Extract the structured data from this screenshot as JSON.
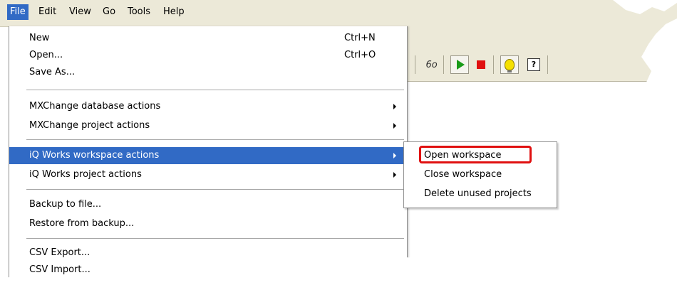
{
  "menubar": {
    "items": [
      {
        "label": "File"
      },
      {
        "label": "Edit"
      },
      {
        "label": "View"
      },
      {
        "label": "Go"
      },
      {
        "label": "Tools"
      },
      {
        "label": "Help"
      }
    ]
  },
  "file_menu": {
    "items": [
      {
        "label": "New",
        "shortcut": "Ctrl+N"
      },
      {
        "label": "Open...",
        "shortcut": "Ctrl+O"
      },
      {
        "label": "Save As..."
      },
      {
        "label": "MXChange database actions"
      },
      {
        "label": "MXChange project actions"
      },
      {
        "label": "iQ Works workspace actions"
      },
      {
        "label": "iQ Works project actions"
      },
      {
        "label": "Backup to file..."
      },
      {
        "label": "Restore from backup..."
      },
      {
        "label": "CSV Export..."
      },
      {
        "label": "CSV Import..."
      }
    ]
  },
  "workspace_submenu": {
    "items": [
      {
        "label": "Open workspace"
      },
      {
        "label": "Close workspace"
      },
      {
        "label": "Delete unused projects"
      }
    ]
  },
  "toolbar": {
    "icons": [
      "glasses-icon",
      "play-icon",
      "stop-icon",
      "lightbulb-icon",
      "help-icon"
    ],
    "help_glyph": "?"
  },
  "colors": {
    "menu_highlight": "#316ac5",
    "annotation_box": "#e01010",
    "chrome": "#ece9d8"
  }
}
